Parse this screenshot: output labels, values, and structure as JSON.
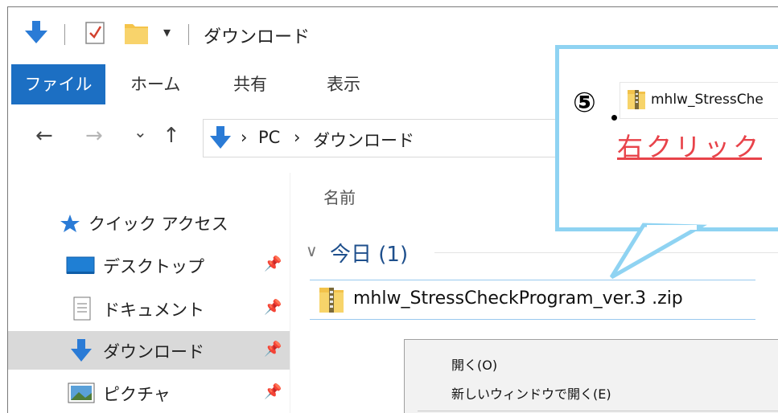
{
  "window": {
    "title": "ダウンロード",
    "qa_dropdown": "▾"
  },
  "ribbon": {
    "tabs": [
      {
        "label": "ファイル"
      },
      {
        "label": "ホーム"
      },
      {
        "label": "共有"
      },
      {
        "label": "表示"
      }
    ]
  },
  "address": {
    "back": "←",
    "forward": "→",
    "recent": "⌄",
    "up": "↑",
    "crumbs": [
      "PC",
      "ダウンロード"
    ],
    "sep": "›"
  },
  "nav_pane": {
    "items": [
      {
        "label": "クイック アクセス"
      },
      {
        "label": "デスクトップ"
      },
      {
        "label": "ドキュメント"
      },
      {
        "label": "ダウンロード"
      },
      {
        "label": "ピクチャ"
      }
    ]
  },
  "content": {
    "column_name": "名前",
    "group": "今日 (1)",
    "group_chevron": "∨",
    "files": [
      {
        "name": "mhlw_StressCheckProgram_ver.3 .zip"
      }
    ]
  },
  "context_menu": {
    "items": [
      {
        "label": "開く(O)"
      },
      {
        "label": "新しいウィンドウで開く(E)"
      }
    ]
  },
  "callout": {
    "step": "⑤",
    "file_label": "mhlw_StressChe",
    "instruction": "右クリック",
    "border_color": "#8fd3f2",
    "text_color": "#e8434a"
  },
  "colors": {
    "accent": "#1c6fc3",
    "selection": "#d9d9d9",
    "row_highlight": "#99c9ef"
  }
}
